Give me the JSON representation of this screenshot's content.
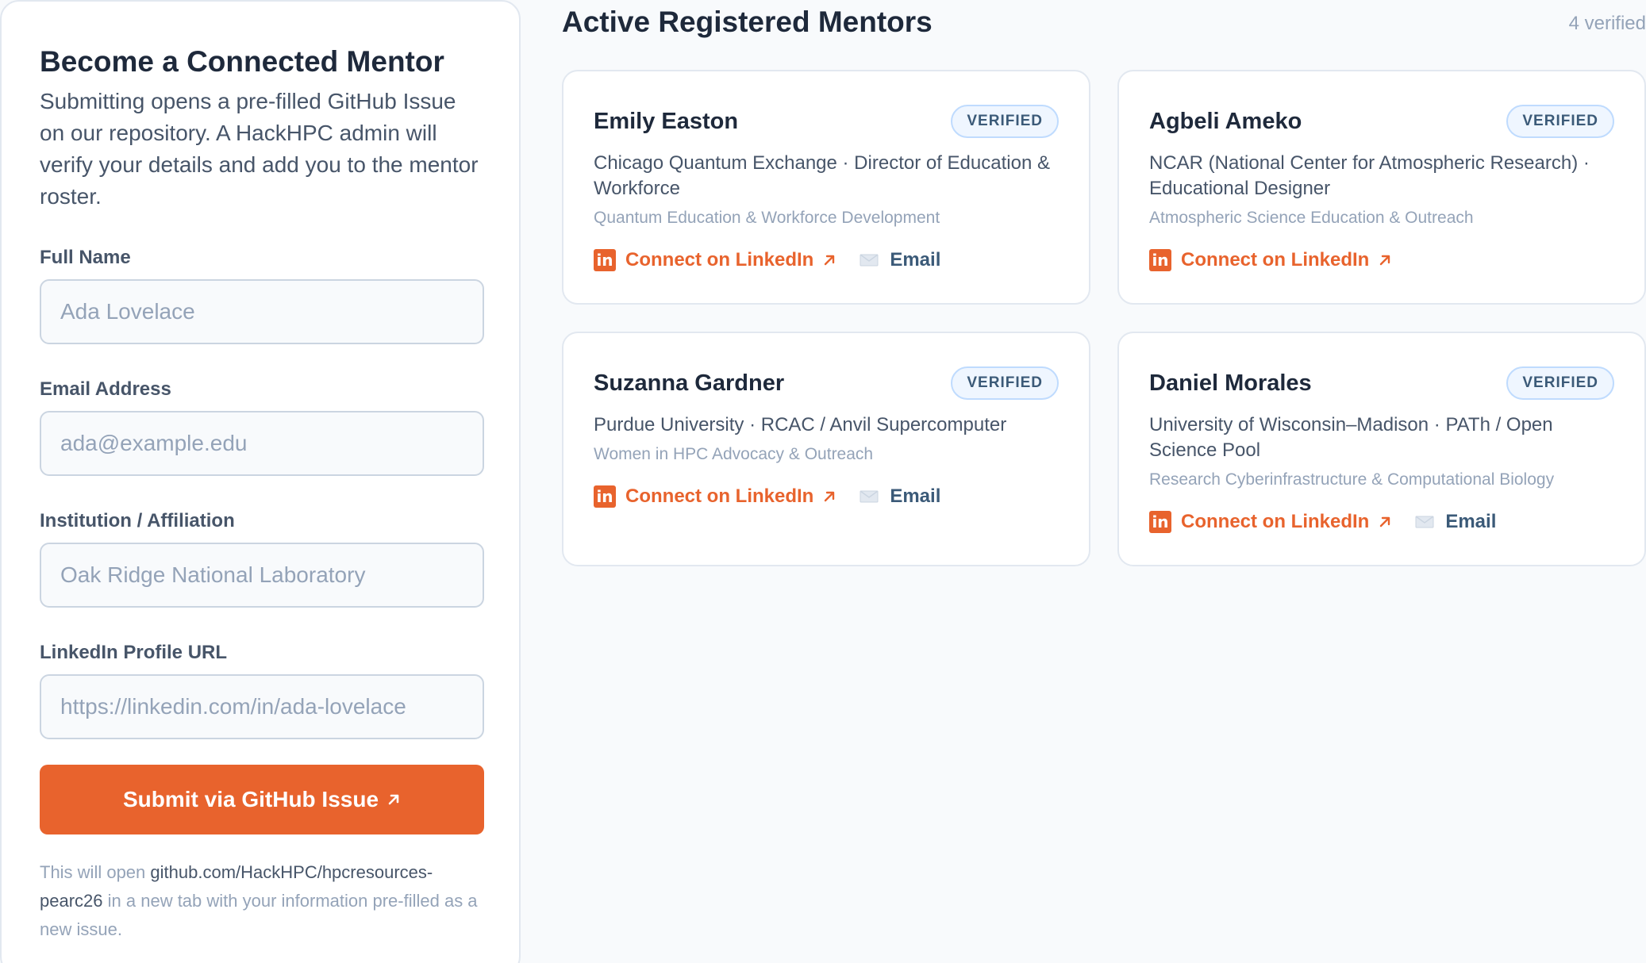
{
  "form": {
    "title": "Become a Connected Mentor",
    "description": "Submitting opens a pre-filled GitHub Issue on our repository. A HackHPC admin will verify your details and add you to the mentor roster.",
    "fields": {
      "full_name": {
        "label": "Full Name",
        "placeholder": "Ada Lovelace",
        "value": ""
      },
      "email": {
        "label": "Email Address",
        "placeholder": "ada@example.edu",
        "value": ""
      },
      "institution": {
        "label": "Institution / Affiliation",
        "placeholder": "Oak Ridge National Laboratory",
        "value": ""
      },
      "linkedin": {
        "label": "LinkedIn Profile URL",
        "placeholder": "https://linkedin.com/in/ada-lovelace",
        "value": ""
      }
    },
    "submit_label": "Submit via GitHub Issue",
    "submit_icon": "external-arrow-icon",
    "note_prefix": "This will open",
    "note_repo": "github.com/HackHPC/hpcresources-pearc26",
    "note_suffix": "in a new tab with your information pre-filled as a new issue."
  },
  "mentors_section": {
    "title": "Active Registered Mentors",
    "count_label": "4 verified"
  },
  "mentors": [
    {
      "name": "Emily Easton",
      "badge": "VERIFIED",
      "affiliation": "Chicago Quantum Exchange · Director of Education & Workforce",
      "focus": "Quantum Education & Workforce Development",
      "linkedin_label": "Connect on LinkedIn",
      "email_label": "Email",
      "has_email": true
    },
    {
      "name": "Agbeli Ameko",
      "badge": "VERIFIED",
      "affiliation": "NCAR (National Center for Atmospheric Research) · Educational Designer",
      "focus": "Atmospheric Science Education & Outreach",
      "linkedin_label": "Connect on LinkedIn",
      "email_label": "",
      "has_email": false
    },
    {
      "name": "Suzanna Gardner",
      "badge": "VERIFIED",
      "affiliation": "Purdue University · RCAC / Anvil Supercomputer",
      "focus": "Women in HPC Advocacy & Outreach",
      "linkedin_label": "Connect on LinkedIn",
      "email_label": "Email",
      "has_email": true
    },
    {
      "name": "Daniel Morales",
      "badge": "VERIFIED",
      "affiliation": "University of Wisconsin–Madison · PATh / Open Science Pool",
      "focus": "Research Cyberinfrastructure & Computational Biology",
      "linkedin_label": "Connect on LinkedIn",
      "email_label": "Email",
      "has_email": true
    }
  ],
  "icons": {
    "linkedin": "linkedin-icon",
    "email": "mail-icon",
    "external": "external-arrow-icon"
  },
  "colors": {
    "accent": "#e8632d",
    "link_blue": "#3b5a78",
    "badge_bg": "#eff6ff",
    "badge_border": "#bfdbfe",
    "text_dark": "#1e293b",
    "text_muted": "#94a3b8",
    "background": "#f8fafc"
  }
}
